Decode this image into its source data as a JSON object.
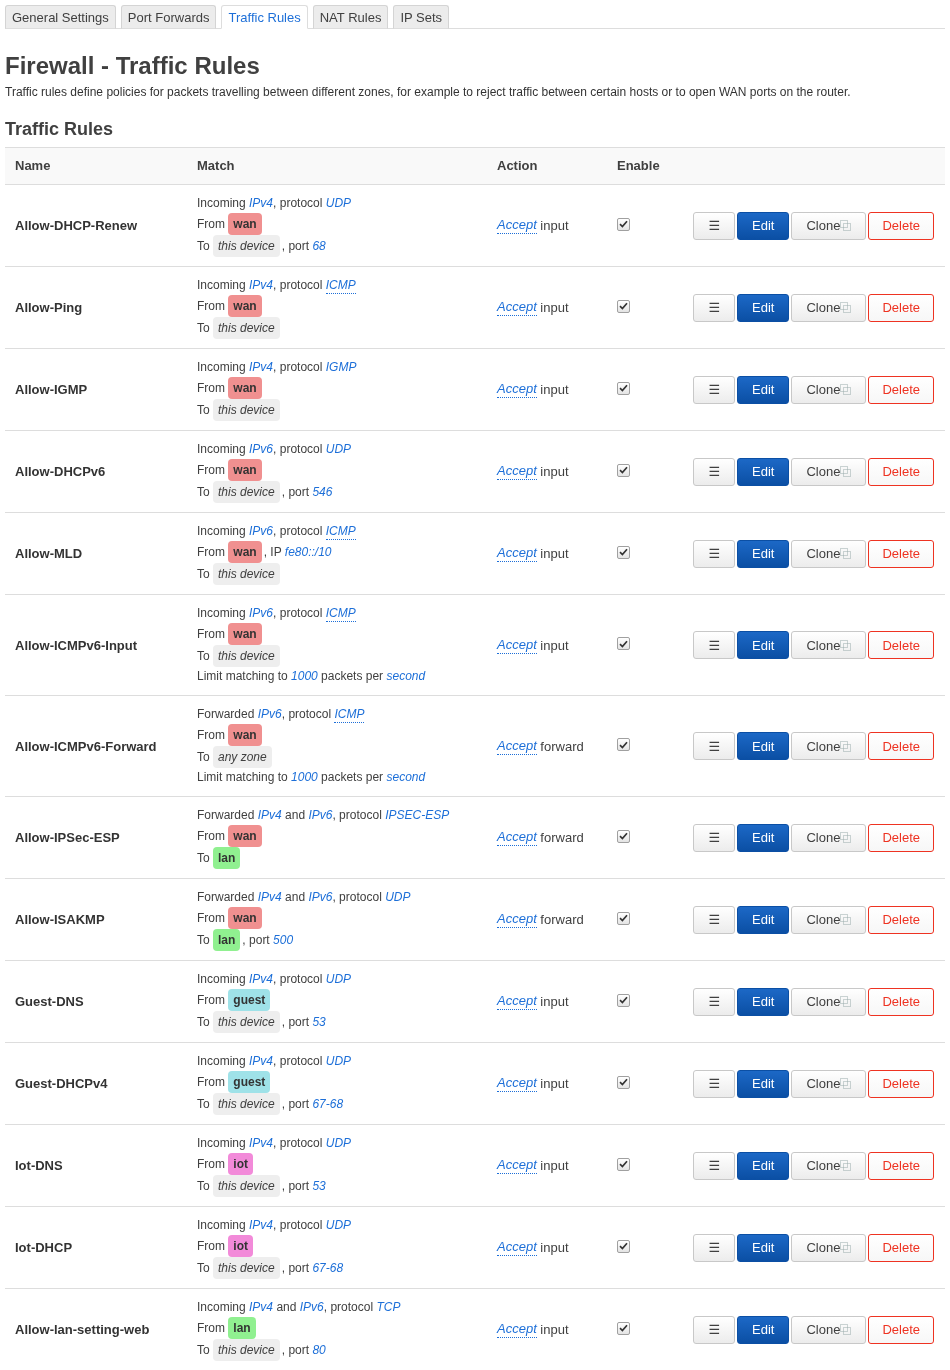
{
  "tabs": [
    {
      "label": "General Settings",
      "selected": false
    },
    {
      "label": "Port Forwards",
      "selected": false
    },
    {
      "label": "Traffic Rules",
      "selected": true
    },
    {
      "label": "NAT Rules",
      "selected": false
    },
    {
      "label": "IP Sets",
      "selected": false
    }
  ],
  "title": "Firewall - Traffic Rules",
  "description": "Traffic rules define policies for packets travelling between different zones, for example to reject traffic between certain hosts or to open WAN ports on the router.",
  "section_title": "Traffic Rules",
  "table": {
    "columns": [
      "Name",
      "Match",
      "Action",
      "Enable"
    ],
    "rows": [
      {
        "name": "Allow-DHCP-Renew",
        "match": [
          [
            {
              "kind": "text",
              "text": "Incoming "
            },
            {
              "kind": "value",
              "text": "IPv4"
            },
            {
              "kind": "text",
              "text": ", protocol "
            },
            {
              "kind": "value",
              "text": "UDP"
            }
          ],
          [
            {
              "kind": "text",
              "text": "From "
            },
            {
              "kind": "zone",
              "text": "wan",
              "color": "#f09090"
            }
          ],
          [
            {
              "kind": "text",
              "text": "To "
            },
            {
              "kind": "device",
              "text": "this device"
            },
            {
              "kind": "text",
              "text": ", port "
            },
            {
              "kind": "value",
              "text": "68"
            }
          ]
        ],
        "action": {
          "verb": "Accept",
          "target": "input"
        },
        "enabled": true,
        "buttons": [
          {
            "kind": "handle",
            "label": "☰"
          },
          {
            "kind": "edit",
            "label": "Edit"
          },
          {
            "kind": "clone",
            "label": "Clone"
          },
          {
            "kind": "delete",
            "label": "Delete"
          }
        ]
      },
      {
        "name": "Allow-Ping",
        "match": [
          [
            {
              "kind": "text",
              "text": "Incoming "
            },
            {
              "kind": "value",
              "text": "IPv4"
            },
            {
              "kind": "text",
              "text": ", protocol "
            },
            {
              "kind": "abbr",
              "text": "ICMP"
            }
          ],
          [
            {
              "kind": "text",
              "text": "From "
            },
            {
              "kind": "zone",
              "text": "wan",
              "color": "#f09090"
            }
          ],
          [
            {
              "kind": "text",
              "text": "To "
            },
            {
              "kind": "device",
              "text": "this device"
            }
          ]
        ],
        "action": {
          "verb": "Accept",
          "target": "input"
        },
        "enabled": true,
        "buttons": [
          {
            "kind": "handle",
            "label": "☰"
          },
          {
            "kind": "edit",
            "label": "Edit"
          },
          {
            "kind": "clone",
            "label": "Clone"
          },
          {
            "kind": "delete",
            "label": "Delete"
          }
        ]
      },
      {
        "name": "Allow-IGMP",
        "match": [
          [
            {
              "kind": "text",
              "text": "Incoming "
            },
            {
              "kind": "value",
              "text": "IPv4"
            },
            {
              "kind": "text",
              "text": ", protocol "
            },
            {
              "kind": "value",
              "text": "IGMP"
            }
          ],
          [
            {
              "kind": "text",
              "text": "From "
            },
            {
              "kind": "zone",
              "text": "wan",
              "color": "#f09090"
            }
          ],
          [
            {
              "kind": "text",
              "text": "To "
            },
            {
              "kind": "device",
              "text": "this device"
            }
          ]
        ],
        "action": {
          "verb": "Accept",
          "target": "input"
        },
        "enabled": true,
        "buttons": [
          {
            "kind": "handle",
            "label": "☰"
          },
          {
            "kind": "edit",
            "label": "Edit"
          },
          {
            "kind": "clone",
            "label": "Clone"
          },
          {
            "kind": "delete",
            "label": "Delete"
          }
        ]
      },
      {
        "name": "Allow-DHCPv6",
        "match": [
          [
            {
              "kind": "text",
              "text": "Incoming "
            },
            {
              "kind": "value",
              "text": "IPv6"
            },
            {
              "kind": "text",
              "text": ", protocol "
            },
            {
              "kind": "value",
              "text": "UDP"
            }
          ],
          [
            {
              "kind": "text",
              "text": "From "
            },
            {
              "kind": "zone",
              "text": "wan",
              "color": "#f09090"
            }
          ],
          [
            {
              "kind": "text",
              "text": "To "
            },
            {
              "kind": "device",
              "text": "this device"
            },
            {
              "kind": "text",
              "text": ", port "
            },
            {
              "kind": "value",
              "text": "546"
            }
          ]
        ],
        "action": {
          "verb": "Accept",
          "target": "input"
        },
        "enabled": true,
        "buttons": [
          {
            "kind": "handle",
            "label": "☰"
          },
          {
            "kind": "edit",
            "label": "Edit"
          },
          {
            "kind": "clone",
            "label": "Clone"
          },
          {
            "kind": "delete",
            "label": "Delete"
          }
        ]
      },
      {
        "name": "Allow-MLD",
        "match": [
          [
            {
              "kind": "text",
              "text": "Incoming "
            },
            {
              "kind": "value",
              "text": "IPv6"
            },
            {
              "kind": "text",
              "text": ", protocol "
            },
            {
              "kind": "abbr",
              "text": "ICMP"
            }
          ],
          [
            {
              "kind": "text",
              "text": "From "
            },
            {
              "kind": "zone",
              "text": "wan",
              "color": "#f09090"
            },
            {
              "kind": "text",
              "text": ", IP "
            },
            {
              "kind": "value",
              "text": "fe80::/10"
            }
          ],
          [
            {
              "kind": "text",
              "text": "To "
            },
            {
              "kind": "device",
              "text": "this device"
            }
          ]
        ],
        "action": {
          "verb": "Accept",
          "target": "input"
        },
        "enabled": true,
        "buttons": [
          {
            "kind": "handle",
            "label": "☰"
          },
          {
            "kind": "edit",
            "label": "Edit"
          },
          {
            "kind": "clone",
            "label": "Clone"
          },
          {
            "kind": "delete",
            "label": "Delete"
          }
        ]
      },
      {
        "name": "Allow-ICMPv6-Input",
        "match": [
          [
            {
              "kind": "text",
              "text": "Incoming "
            },
            {
              "kind": "value",
              "text": "IPv6"
            },
            {
              "kind": "text",
              "text": ", protocol "
            },
            {
              "kind": "abbr",
              "text": "ICMP"
            }
          ],
          [
            {
              "kind": "text",
              "text": "From "
            },
            {
              "kind": "zone",
              "text": "wan",
              "color": "#f09090"
            }
          ],
          [
            {
              "kind": "text",
              "text": "To "
            },
            {
              "kind": "device",
              "text": "this device"
            }
          ],
          [
            {
              "kind": "text",
              "text": "Limit matching to "
            },
            {
              "kind": "value",
              "text": "1000"
            },
            {
              "kind": "text",
              "text": " packets per "
            },
            {
              "kind": "value",
              "text": "second"
            }
          ]
        ],
        "action": {
          "verb": "Accept",
          "target": "input"
        },
        "enabled": true,
        "buttons": [
          {
            "kind": "handle",
            "label": "☰"
          },
          {
            "kind": "edit",
            "label": "Edit"
          },
          {
            "kind": "clone",
            "label": "Clone"
          },
          {
            "kind": "delete",
            "label": "Delete"
          }
        ]
      },
      {
        "name": "Allow-ICMPv6-Forward",
        "match": [
          [
            {
              "kind": "text",
              "text": "Forwarded "
            },
            {
              "kind": "value",
              "text": "IPv6"
            },
            {
              "kind": "text",
              "text": ", protocol "
            },
            {
              "kind": "abbr",
              "text": "ICMP"
            }
          ],
          [
            {
              "kind": "text",
              "text": "From "
            },
            {
              "kind": "zone",
              "text": "wan",
              "color": "#f09090"
            }
          ],
          [
            {
              "kind": "text",
              "text": "To "
            },
            {
              "kind": "device",
              "text": "any zone"
            }
          ],
          [
            {
              "kind": "text",
              "text": "Limit matching to "
            },
            {
              "kind": "value",
              "text": "1000"
            },
            {
              "kind": "text",
              "text": " packets per "
            },
            {
              "kind": "value",
              "text": "second"
            }
          ]
        ],
        "action": {
          "verb": "Accept",
          "target": "forward"
        },
        "enabled": true,
        "buttons": [
          {
            "kind": "handle",
            "label": "☰"
          },
          {
            "kind": "edit",
            "label": "Edit"
          },
          {
            "kind": "clone",
            "label": "Clone"
          },
          {
            "kind": "delete",
            "label": "Delete"
          }
        ]
      },
      {
        "name": "Allow-IPSec-ESP",
        "match": [
          [
            {
              "kind": "text",
              "text": "Forwarded "
            },
            {
              "kind": "value",
              "text": "IPv4"
            },
            {
              "kind": "text",
              "text": " and "
            },
            {
              "kind": "value",
              "text": "IPv6"
            },
            {
              "kind": "text",
              "text": ", protocol "
            },
            {
              "kind": "value",
              "text": "IPSEC-ESP"
            }
          ],
          [
            {
              "kind": "text",
              "text": "From "
            },
            {
              "kind": "zone",
              "text": "wan",
              "color": "#f09090"
            }
          ],
          [
            {
              "kind": "text",
              "text": "To "
            },
            {
              "kind": "zone",
              "text": "lan",
              "color": "#90f090"
            }
          ]
        ],
        "action": {
          "verb": "Accept",
          "target": "forward"
        },
        "enabled": true,
        "buttons": [
          {
            "kind": "handle",
            "label": "☰"
          },
          {
            "kind": "edit",
            "label": "Edit"
          },
          {
            "kind": "clone",
            "label": "Clone"
          },
          {
            "kind": "delete",
            "label": "Delete"
          }
        ]
      },
      {
        "name": "Allow-ISAKMP",
        "match": [
          [
            {
              "kind": "text",
              "text": "Forwarded "
            },
            {
              "kind": "value",
              "text": "IPv4"
            },
            {
              "kind": "text",
              "text": " and "
            },
            {
              "kind": "value",
              "text": "IPv6"
            },
            {
              "kind": "text",
              "text": ", protocol "
            },
            {
              "kind": "value",
              "text": "UDP"
            }
          ],
          [
            {
              "kind": "text",
              "text": "From "
            },
            {
              "kind": "zone",
              "text": "wan",
              "color": "#f09090"
            }
          ],
          [
            {
              "kind": "text",
              "text": "To "
            },
            {
              "kind": "zone",
              "text": "lan",
              "color": "#90f090"
            },
            {
              "kind": "text",
              "text": ", port "
            },
            {
              "kind": "value",
              "text": "500"
            }
          ]
        ],
        "action": {
          "verb": "Accept",
          "target": "forward"
        },
        "enabled": true,
        "buttons": [
          {
            "kind": "handle",
            "label": "☰"
          },
          {
            "kind": "edit",
            "label": "Edit"
          },
          {
            "kind": "clone",
            "label": "Clone"
          },
          {
            "kind": "delete",
            "label": "Delete"
          }
        ]
      },
      {
        "name": "Guest-DNS",
        "match": [
          [
            {
              "kind": "text",
              "text": "Incoming "
            },
            {
              "kind": "value",
              "text": "IPv4"
            },
            {
              "kind": "text",
              "text": ", protocol "
            },
            {
              "kind": "value",
              "text": "UDP"
            }
          ],
          [
            {
              "kind": "text",
              "text": "From "
            },
            {
              "kind": "zone",
              "text": "guest",
              "color": "#9fe2e8"
            }
          ],
          [
            {
              "kind": "text",
              "text": "To "
            },
            {
              "kind": "device",
              "text": "this device"
            },
            {
              "kind": "text",
              "text": ", port "
            },
            {
              "kind": "value",
              "text": "53"
            }
          ]
        ],
        "action": {
          "verb": "Accept",
          "target": "input"
        },
        "enabled": true,
        "buttons": [
          {
            "kind": "handle",
            "label": "☰"
          },
          {
            "kind": "edit",
            "label": "Edit"
          },
          {
            "kind": "clone",
            "label": "Clone"
          },
          {
            "kind": "delete",
            "label": "Delete"
          }
        ]
      },
      {
        "name": "Guest-DHCPv4",
        "match": [
          [
            {
              "kind": "text",
              "text": "Incoming "
            },
            {
              "kind": "value",
              "text": "IPv4"
            },
            {
              "kind": "text",
              "text": ", protocol "
            },
            {
              "kind": "value",
              "text": "UDP"
            }
          ],
          [
            {
              "kind": "text",
              "text": "From "
            },
            {
              "kind": "zone",
              "text": "guest",
              "color": "#9fe2e8"
            }
          ],
          [
            {
              "kind": "text",
              "text": "To "
            },
            {
              "kind": "device",
              "text": "this device"
            },
            {
              "kind": "text",
              "text": ", port "
            },
            {
              "kind": "value",
              "text": "67-68"
            }
          ]
        ],
        "action": {
          "verb": "Accept",
          "target": "input"
        },
        "enabled": true,
        "buttons": [
          {
            "kind": "handle",
            "label": "☰"
          },
          {
            "kind": "edit",
            "label": "Edit"
          },
          {
            "kind": "clone",
            "label": "Clone"
          },
          {
            "kind": "delete",
            "label": "Delete"
          }
        ]
      },
      {
        "name": "Iot-DNS",
        "match": [
          [
            {
              "kind": "text",
              "text": "Incoming "
            },
            {
              "kind": "value",
              "text": "IPv4"
            },
            {
              "kind": "text",
              "text": ", protocol "
            },
            {
              "kind": "value",
              "text": "UDP"
            }
          ],
          [
            {
              "kind": "text",
              "text": "From "
            },
            {
              "kind": "zone",
              "text": "iot",
              "color": "#f28ad9"
            }
          ],
          [
            {
              "kind": "text",
              "text": "To "
            },
            {
              "kind": "device",
              "text": "this device"
            },
            {
              "kind": "text",
              "text": ", port "
            },
            {
              "kind": "value",
              "text": "53"
            }
          ]
        ],
        "action": {
          "verb": "Accept",
          "target": "input"
        },
        "enabled": true,
        "buttons": [
          {
            "kind": "handle",
            "label": "☰"
          },
          {
            "kind": "edit",
            "label": "Edit"
          },
          {
            "kind": "clone",
            "label": "Clone"
          },
          {
            "kind": "delete",
            "label": "Delete"
          }
        ]
      },
      {
        "name": "Iot-DHCP",
        "match": [
          [
            {
              "kind": "text",
              "text": "Incoming "
            },
            {
              "kind": "value",
              "text": "IPv4"
            },
            {
              "kind": "text",
              "text": ", protocol "
            },
            {
              "kind": "value",
              "text": "UDP"
            }
          ],
          [
            {
              "kind": "text",
              "text": "From "
            },
            {
              "kind": "zone",
              "text": "iot",
              "color": "#f28ad9"
            }
          ],
          [
            {
              "kind": "text",
              "text": "To "
            },
            {
              "kind": "device",
              "text": "this device"
            },
            {
              "kind": "text",
              "text": ", port "
            },
            {
              "kind": "value",
              "text": "67-68"
            }
          ]
        ],
        "action": {
          "verb": "Accept",
          "target": "input"
        },
        "enabled": true,
        "buttons": [
          {
            "kind": "handle",
            "label": "☰"
          },
          {
            "kind": "edit",
            "label": "Edit"
          },
          {
            "kind": "clone",
            "label": "Clone"
          },
          {
            "kind": "delete",
            "label": "Delete"
          }
        ]
      },
      {
        "name": "Allow-lan-setting-web",
        "match": [
          [
            {
              "kind": "text",
              "text": "Incoming "
            },
            {
              "kind": "value",
              "text": "IPv4"
            },
            {
              "kind": "text",
              "text": " and "
            },
            {
              "kind": "value",
              "text": "IPv6"
            },
            {
              "kind": "text",
              "text": ", protocol "
            },
            {
              "kind": "value",
              "text": "TCP"
            }
          ],
          [
            {
              "kind": "text",
              "text": "From "
            },
            {
              "kind": "zone",
              "text": "lan",
              "color": "#90f090"
            }
          ],
          [
            {
              "kind": "text",
              "text": "To "
            },
            {
              "kind": "device",
              "text": "this device"
            },
            {
              "kind": "text",
              "text": ", port "
            },
            {
              "kind": "value",
              "text": "80"
            }
          ]
        ],
        "action": {
          "verb": "Accept",
          "target": "input"
        },
        "enabled": true,
        "buttons": [
          {
            "kind": "handle",
            "label": "☰"
          },
          {
            "kind": "edit",
            "label": "Edit"
          },
          {
            "kind": "clone",
            "label": "Clone"
          },
          {
            "kind": "delete",
            "label": "Delete"
          }
        ]
      }
    ]
  }
}
